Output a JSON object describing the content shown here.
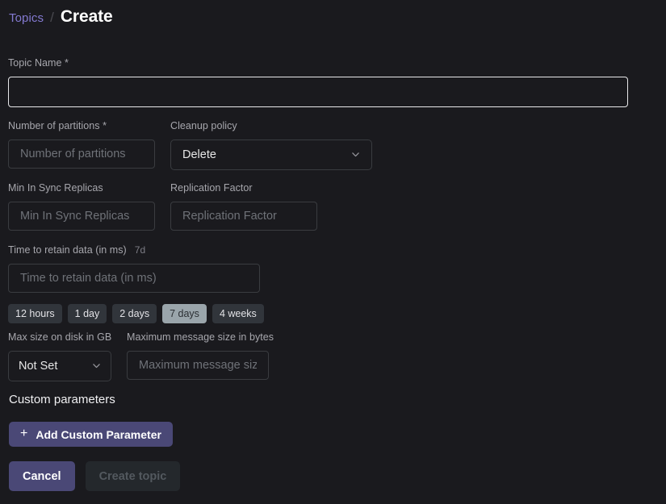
{
  "theme": {
    "background": "#1a1a1e",
    "accent_purple": "#4a4876",
    "link_purple": "#8379d0",
    "border": "#3a3c40",
    "chip_bg": "#31353b",
    "chip_selected_bg": "#9aa5ab",
    "disabled_bg": "#24282c",
    "disabled_text": "#53595f"
  },
  "breadcrumb": {
    "parent": "Topics",
    "separator": "/",
    "current": "Create"
  },
  "form": {
    "topic_name": {
      "label": "Topic Name *",
      "value": "",
      "placeholder": ""
    },
    "number_of_partitions": {
      "label": "Number of partitions *",
      "value": "",
      "placeholder": "Number of partitions"
    },
    "cleanup_policy": {
      "label": "Cleanup policy",
      "selected": "Delete",
      "icon": "chevron-down-icon"
    },
    "min_in_sync_replicas": {
      "label": "Min In Sync Replicas",
      "value": "",
      "placeholder": "Min In Sync Replicas"
    },
    "replication_factor": {
      "label": "Replication Factor",
      "value": "",
      "placeholder": "Replication Factor"
    },
    "time_to_retain": {
      "label": "Time to retain data (in ms)",
      "hint": "7d",
      "value": "",
      "placeholder": "Time to retain data (in ms)",
      "presets": [
        {
          "label": "12 hours",
          "selected": false
        },
        {
          "label": "1 day",
          "selected": false
        },
        {
          "label": "2 days",
          "selected": false
        },
        {
          "label": "7 days",
          "selected": true
        },
        {
          "label": "4 weeks",
          "selected": false
        }
      ]
    },
    "max_size_on_disk": {
      "label": "Max size on disk in GB",
      "selected": "Not Set",
      "icon": "chevron-down-icon"
    },
    "max_message_size": {
      "label": "Maximum message size in bytes",
      "value": "",
      "placeholder": "Maximum message size in bytes"
    }
  },
  "custom_parameters": {
    "title": "Custom parameters",
    "add_button_label": "Add Custom Parameter",
    "add_button_icon": "plus-icon"
  },
  "actions": {
    "cancel_label": "Cancel",
    "create_label": "Create topic",
    "create_disabled": true
  }
}
